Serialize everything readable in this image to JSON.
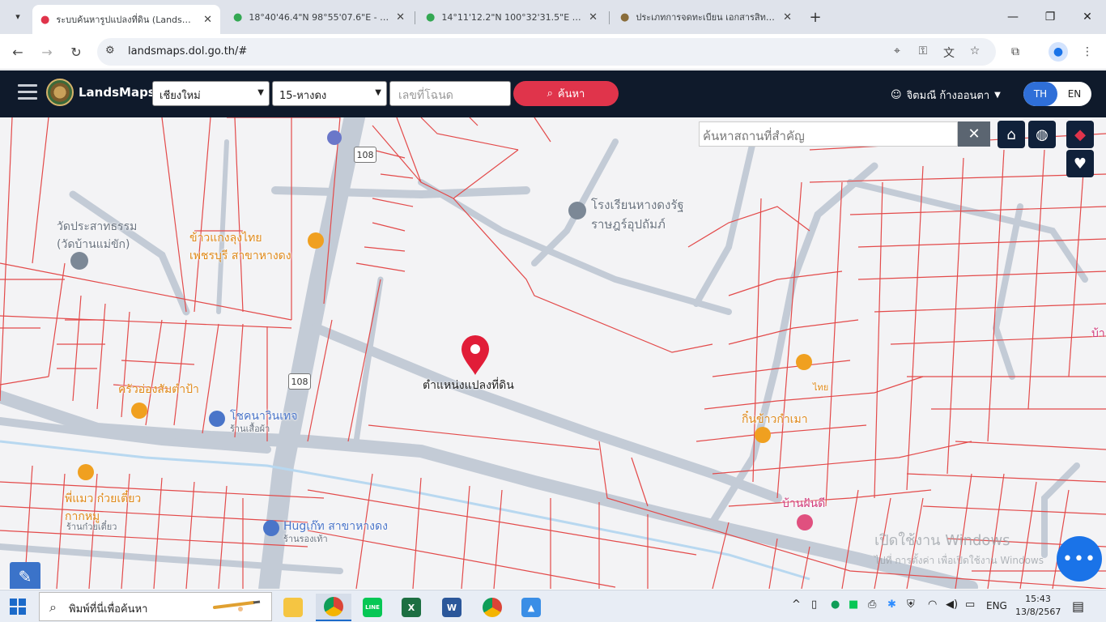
{
  "browser": {
    "tabs": [
      {
        "title": "ระบบค้นหารูปแปลงที่ดิน (LandsMaps)",
        "icon": "map-pin-icon",
        "active": true
      },
      {
        "title": "18°40'46.4\"N 98°55'07.6\"E - Goo",
        "icon": "google-maps-icon",
        "active": false
      },
      {
        "title": "14°11'12.2\"N 100°32'31.5\"E - Go",
        "icon": "google-maps-icon",
        "active": false
      },
      {
        "title": "ประเภทการจดทะเบียน เอกสารสิทธิ์ แ",
        "icon": "dol-seal-icon",
        "active": false
      }
    ],
    "new_tab": "+",
    "url": "landsmaps.dol.go.th/#"
  },
  "app": {
    "brand": "LandsMaps",
    "province": "เชียงใหม่",
    "district": "15-หางดง",
    "deed_placeholder": "เลขที่โฉนด",
    "search_label": "ค้นหา",
    "user_name": "จิตมณี ก้างออนตา",
    "lang_th": "TH",
    "lang_en": "EN"
  },
  "map": {
    "place_search_placeholder": "ค้นหาสถานที่สำคัญ",
    "marker_label": "ตำแหน่งแปลงที่ดิน",
    "road_shield": "108",
    "pois": {
      "school": "โรงเรียนหางดงรัฐ\nราษฎร์อุปถัมภ์",
      "temple": "วัดประสาทธรรม\n(วัดบ้านแม่ขัก)",
      "restaurant_top": "ข้าวแกงลุงไทย\nเพชรบุรี สาขาหางดง",
      "restaurant_left": "ครัวอ่องสัมตำป้า",
      "shop_center": "โชคนาวินเทจ",
      "shop_center_sub": "ร้านเสื้อผ้า",
      "noodle": "พี่แมว ก๋วยเตี๋ยว\nกากหมู",
      "noodle_sub": "ร้านก๋วยเตี๋ยว",
      "hug": "Hugเก๊ท สาขาหางดง",
      "hug_sub": "ร้านรองเท้า",
      "restaurant_right": "กิ๋นข้าวกำเมา",
      "thai_small": "ไทย",
      "baan": "บ้านฝันดี",
      "edge": "บ้า"
    },
    "watermark_line1": "เปิดใช้งาน Windows",
    "watermark_line2": "ไปที่ การตั้งค่า เพื่อเปิดใช้งาน Windows"
  },
  "taskbar": {
    "search_placeholder": "พิมพ์ที่นี่เพื่อค้นหา",
    "lang": "ENG",
    "time": "15:43",
    "date": "13/8/2567"
  }
}
